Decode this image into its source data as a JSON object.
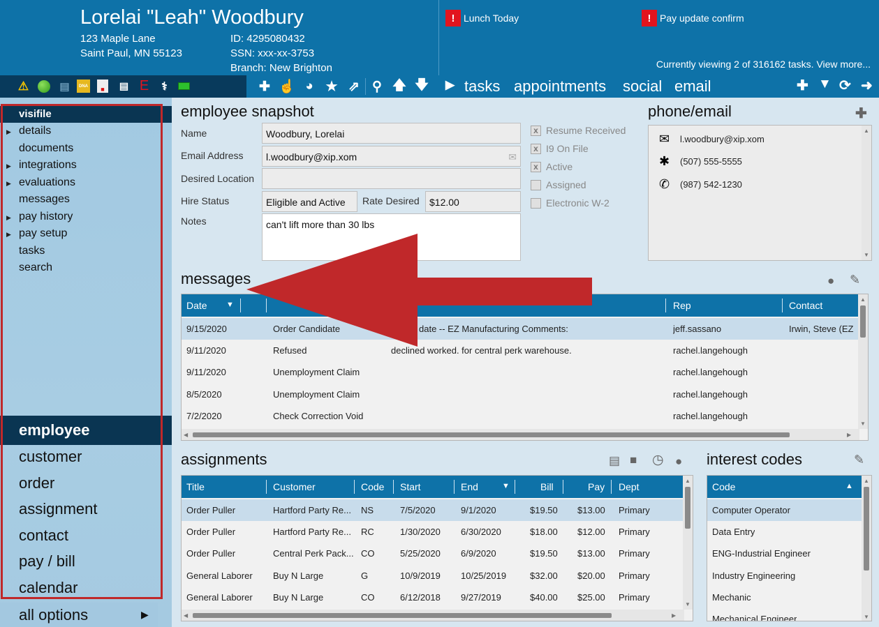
{
  "header": {
    "name": "Lorelai \"Leah\" Woodbury",
    "address1": "123 Maple Lane",
    "address2": "Saint Paul, MN 55123",
    "id": "ID: 4295080432",
    "ssn": "SSN:  xxx-xx-3753",
    "branch": "Branch:  New Brighton",
    "alerts": [
      {
        "badge": "!",
        "label": "Lunch Today"
      },
      {
        "badge": "!",
        "label": "Pay update confirm"
      }
    ],
    "viewing": "Currently viewing 2 of 316162 tasks. View more..."
  },
  "status_icons": [
    "warning-icon",
    "green-dot-icon",
    "document-icon",
    "dna-icon",
    "pdf-icon",
    "card-icon",
    "e-verify-icon",
    "medical-icon",
    "money-icon"
  ],
  "toolbar_icons": [
    "plus-icon",
    "hand-pointer-icon",
    "pie-icon",
    "star-icon",
    "external-link-icon",
    "search-icon",
    "arrow-up-icon",
    "arrow-down-icon"
  ],
  "nav_tabs": {
    "tasks": "tasks",
    "appointments": "appointments",
    "social": "social",
    "email": "email"
  },
  "sidebar": {
    "visifile": "visifile",
    "details": "details",
    "documents": "documents",
    "integrations": "integrations",
    "evaluations": "evaluations",
    "messages": "messages",
    "pay_history": "pay history",
    "pay_setup": "pay setup",
    "tasks": "tasks",
    "search": "search",
    "employee": "employee",
    "customer": "customer",
    "order": "order",
    "assignment": "assignment",
    "contact": "contact",
    "pay_bill": "pay / bill",
    "calendar": "calendar",
    "all_options": "all options"
  },
  "snapshot": {
    "title": "employee snapshot",
    "name_label": "Name",
    "name_value": "Woodbury, Lorelai",
    "email_label": "Email Address",
    "email_value": "l.woodbury@xip.xom",
    "location_label": "Desired Location",
    "location_value": "",
    "hire_label": "Hire Status",
    "hire_value": "Eligible and Active",
    "rate_label": "Rate Desired",
    "rate_value": "$12.00",
    "notes_label": "Notes",
    "notes_value": "can't lift more than 30 lbs",
    "checks": {
      "resume": {
        "label": "Resume Received",
        "checked": "x"
      },
      "i9": {
        "label": "I9 On File",
        "checked": "x"
      },
      "active": {
        "label": "Active",
        "checked": "x"
      },
      "assigned": {
        "label": "Assigned",
        "checked": ""
      },
      "w2": {
        "label": "Electronic W-2",
        "checked": ""
      }
    }
  },
  "phone_email": {
    "title": "phone/email",
    "email": "l.woodbury@xip.xom",
    "phone1": "(507) 555-5555",
    "phone2": "(987) 542-1230"
  },
  "messages": {
    "title": "messages",
    "headers": {
      "date": "Date",
      "action": "",
      "message": "",
      "rep": "Rep",
      "contact": "Contact"
    },
    "rows": [
      {
        "date": "9/15/2020",
        "action": "Order Candidate",
        "message": "date  --  EZ Manufacturing     Comments:",
        "rep": "jeff.sassano",
        "contact": "Irwin, Steve (EZ"
      },
      {
        "date": "9/11/2020",
        "action": "Refused",
        "message": "declined worked. for central perk warehouse.",
        "rep": "rachel.langehough",
        "contact": ""
      },
      {
        "date": "9/11/2020",
        "action": "Unemployment Claim",
        "message": "",
        "rep": "rachel.langehough",
        "contact": ""
      },
      {
        "date": "8/5/2020",
        "action": "Unemployment Claim",
        "message": "",
        "rep": "rachel.langehough",
        "contact": ""
      },
      {
        "date": "7/2/2020",
        "action": "Check Correction Void",
        "message": "",
        "rep": "rachel.langehough",
        "contact": ""
      }
    ]
  },
  "assignments": {
    "title": "assignments",
    "headers": {
      "title": "Title",
      "customer": "Customer",
      "code": "Code",
      "start": "Start",
      "end": "End",
      "bill": "Bill",
      "pay": "Pay",
      "dept": "Dept"
    },
    "rows": [
      {
        "title": "Order Puller",
        "customer": "Hartford Party Re...",
        "code": "NS",
        "start": "7/5/2020",
        "end": "9/1/2020",
        "bill": "$19.50",
        "pay": "$13.00",
        "dept": "Primary"
      },
      {
        "title": "Order Puller",
        "customer": "Hartford Party Re...",
        "code": "RC",
        "start": "1/30/2020",
        "end": "6/30/2020",
        "bill": "$18.00",
        "pay": "$12.00",
        "dept": "Primary"
      },
      {
        "title": "Order Puller",
        "customer": "Central Perk Pack...",
        "code": "CO",
        "start": "5/25/2020",
        "end": "6/9/2020",
        "bill": "$19.50",
        "pay": "$13.00",
        "dept": "Primary"
      },
      {
        "title": "General Laborer",
        "customer": "Buy N Large",
        "code": "G",
        "start": "10/9/2019",
        "end": "10/25/2019",
        "bill": "$32.00",
        "pay": "$20.00",
        "dept": "Primary"
      },
      {
        "title": "General Laborer",
        "customer": "Buy N Large",
        "code": "CO",
        "start": "6/12/2018",
        "end": "9/27/2019",
        "bill": "$40.00",
        "pay": "$25.00",
        "dept": "Primary"
      }
    ]
  },
  "interest_codes": {
    "title": "interest codes",
    "header": "Code",
    "rows": [
      "Computer Operator",
      "Data Entry",
      "ENG-Industrial Engineer",
      "Industry Engineering",
      "Mechanic",
      "Mechanical Engineer"
    ]
  },
  "colors": {
    "brand_blue": "#0e72a8",
    "dark_navy": "#0a3552",
    "alert_red": "#e2141e",
    "annotation_red": "#c0282a"
  }
}
